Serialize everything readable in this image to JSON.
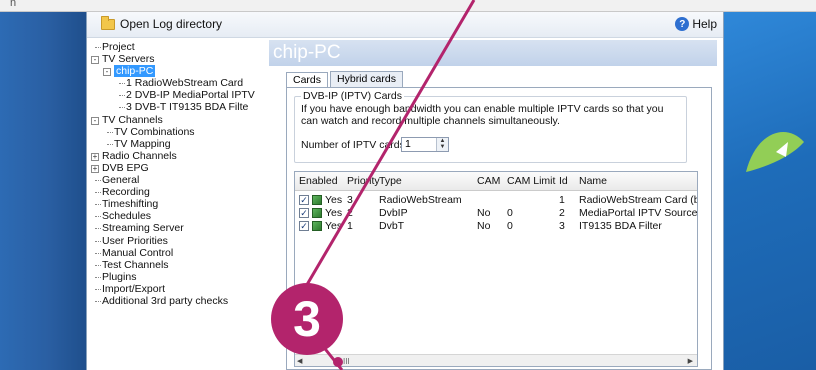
{
  "toolbar": {
    "open_log_label": "Open Log directory",
    "help_label": "Help"
  },
  "top_fragment": "n",
  "tree": {
    "items": [
      {
        "label": "Project",
        "level": 0,
        "expander": ""
      },
      {
        "label": "TV Servers",
        "level": 0,
        "expander": "-"
      },
      {
        "label": "chip-PC",
        "level": 1,
        "expander": "-",
        "selected": true
      },
      {
        "label": "1 RadioWebStream Card",
        "level": 2,
        "expander": ""
      },
      {
        "label": "2 DVB-IP MediaPortal IPTV",
        "level": 2,
        "expander": ""
      },
      {
        "label": "3 DVB-T IT9135 BDA Filte",
        "level": 2,
        "expander": ""
      },
      {
        "label": "TV Channels",
        "level": 0,
        "expander": "-"
      },
      {
        "label": "TV Combinations",
        "level": 1,
        "expander": ""
      },
      {
        "label": "TV Mapping",
        "level": 1,
        "expander": ""
      },
      {
        "label": "Radio Channels",
        "level": 0,
        "expander": "+"
      },
      {
        "label": "DVB EPG",
        "level": 0,
        "expander": "+"
      },
      {
        "label": "General",
        "level": 0,
        "expander": ""
      },
      {
        "label": "Recording",
        "level": 0,
        "expander": ""
      },
      {
        "label": "Timeshifting",
        "level": 0,
        "expander": ""
      },
      {
        "label": "Schedules",
        "level": 0,
        "expander": ""
      },
      {
        "label": "Streaming Server",
        "level": 0,
        "expander": ""
      },
      {
        "label": "User Priorities",
        "level": 0,
        "expander": ""
      },
      {
        "label": "Manual Control",
        "level": 0,
        "expander": ""
      },
      {
        "label": "Test Channels",
        "level": 0,
        "expander": ""
      },
      {
        "label": "Plugins",
        "level": 0,
        "expander": ""
      },
      {
        "label": "Import/Export",
        "level": 0,
        "expander": ""
      },
      {
        "label": "Additional 3rd party checks",
        "level": 0,
        "expander": ""
      }
    ]
  },
  "main": {
    "title": "chip-PC",
    "tabs": [
      {
        "label": "Cards",
        "active": true
      },
      {
        "label": "Hybrid cards",
        "active": false
      }
    ],
    "group": {
      "title": "DVB-IP (IPTV) Cards",
      "description": "If you have enough bandwidth you can enable multiple IPTV cards so that you can watch and record multiple channels simultaneously.",
      "count_label": "Number of IPTV cards",
      "count_value": "1"
    },
    "table": {
      "columns": [
        "Enabled",
        "Priority",
        "Type",
        "CAM",
        "CAM Limit",
        "Id",
        "Name"
      ],
      "rows": [
        {
          "enabled": "Yes",
          "priority": "3",
          "type": "RadioWebStream",
          "cam": "",
          "cam_limit": "",
          "id": "1",
          "name": "RadioWebStream Card (bu"
        },
        {
          "enabled": "Yes",
          "priority": "2",
          "type": "DvbIP",
          "cam": "No",
          "cam_limit": "0",
          "id": "2",
          "name": "MediaPortal IPTV Source I"
        },
        {
          "enabled": "Yes",
          "priority": "1",
          "type": "DvbT",
          "cam": "No",
          "cam_limit": "0",
          "id": "3",
          "name": "IT9135 BDA Filter"
        }
      ],
      "scroll_grip": "III"
    }
  },
  "annotation": {
    "step_number": "3",
    "color": "#b3246c"
  }
}
